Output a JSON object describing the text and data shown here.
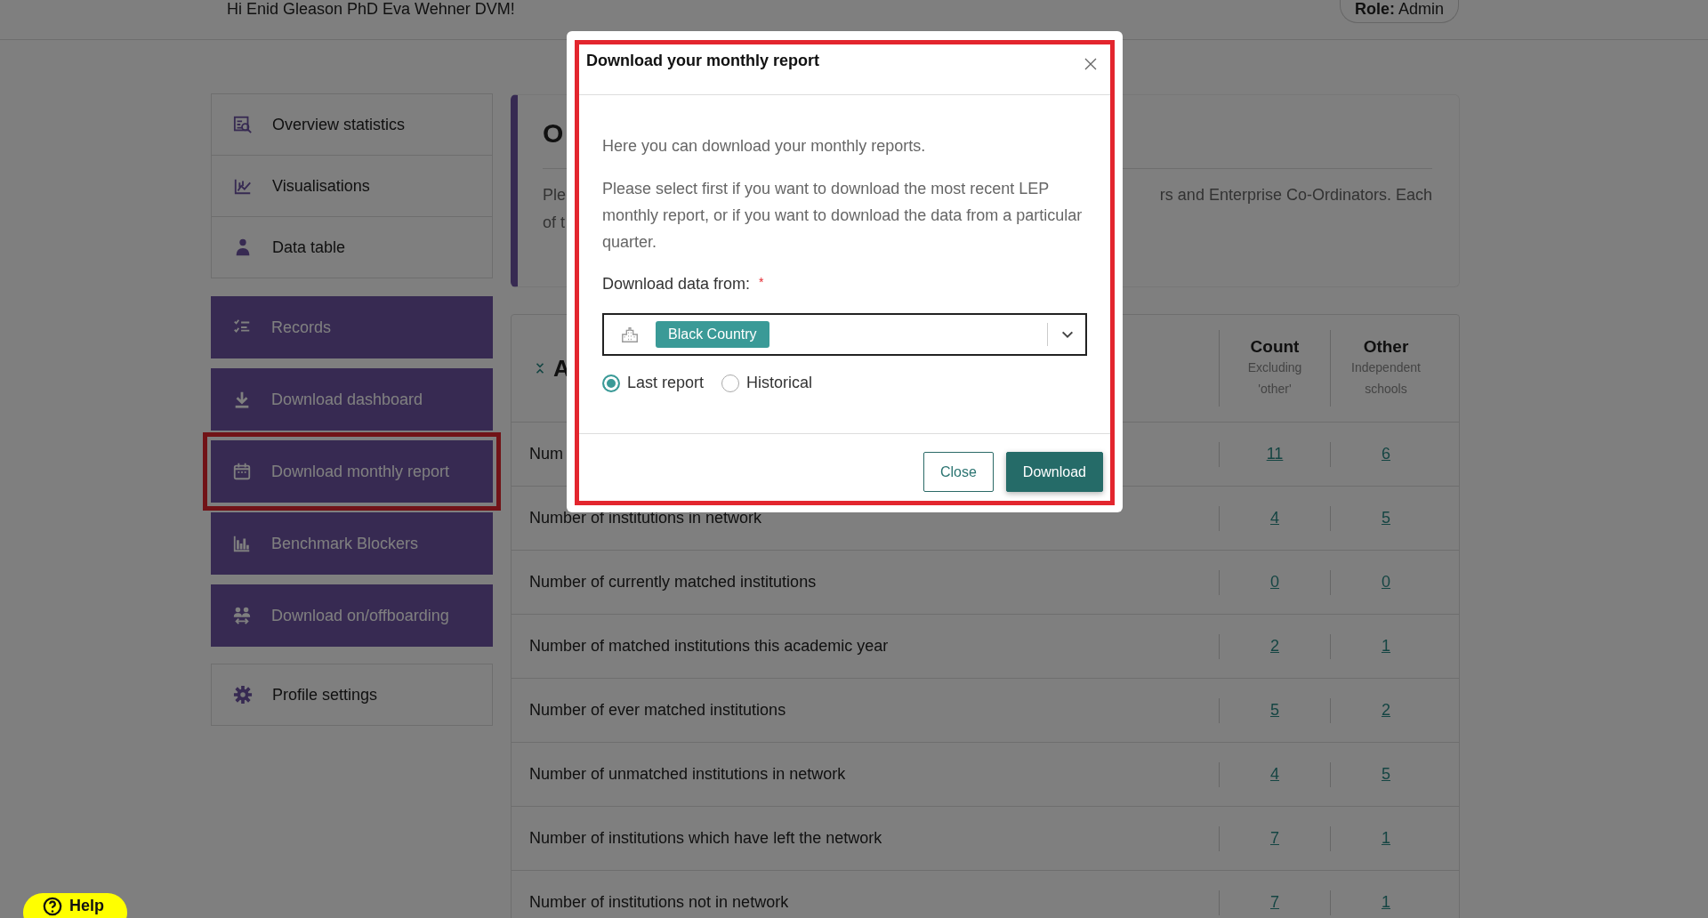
{
  "header": {
    "greeting": "Hi Enid Gleason PhD Eva Wehner DVM!",
    "role_label": "Role:",
    "role_value": "Admin"
  },
  "sidebar": {
    "groups": [
      {
        "kind": "plain",
        "items": [
          {
            "label": "Overview statistics",
            "highlighted": false
          },
          {
            "label": "Visualisations",
            "highlighted": false
          },
          {
            "label": "Data table",
            "highlighted": false
          }
        ]
      },
      {
        "kind": "primary",
        "items": [
          {
            "label": "Records",
            "highlighted": false
          },
          {
            "label": "Download dashboard",
            "highlighted": false
          },
          {
            "label": "Download monthly report",
            "highlighted": true
          },
          {
            "label": "Benchmark Blockers",
            "highlighted": false
          },
          {
            "label": "Download on/offboarding",
            "highlighted": false
          }
        ]
      },
      {
        "kind": "plain",
        "items": [
          {
            "label": "Profile settings",
            "highlighted": false
          }
        ]
      }
    ]
  },
  "overview_card": {
    "title": "O",
    "text_left": [
      "Ple",
      "of t"
    ],
    "text_right": "rs and Enterprise Co-Ordinators. Each"
  },
  "stats_table": {
    "title": "A",
    "columns": [
      {
        "title": "Count",
        "subtitle": "Excluding 'other'"
      },
      {
        "title": "Other",
        "subtitle": "Independent schools"
      }
    ],
    "rows": [
      {
        "label": "Num",
        "count": "11",
        "other": "6"
      },
      {
        "label": "Number of institutions in network",
        "count": "4",
        "other": "5"
      },
      {
        "label": "Number of currently matched institutions",
        "count": "0",
        "other": "0"
      },
      {
        "label": "Number of matched institutions this academic year",
        "count": "2",
        "other": "1"
      },
      {
        "label": "Number of ever matched institutions",
        "count": "5",
        "other": "2"
      },
      {
        "label": "Number of unmatched institutions in network",
        "count": "4",
        "other": "5"
      },
      {
        "label": "Number of institutions which have left the network",
        "count": "7",
        "other": "1"
      },
      {
        "label": "Number of institutions not in network",
        "count": "7",
        "other": "1"
      }
    ]
  },
  "modal": {
    "title": "Download your monthly report",
    "highlighted": true,
    "intro": "Here you can download your monthly reports.",
    "paragraph": "Please select first if you want to download the most recent LEP monthly report, or if you want to download the data from a particular quarter.",
    "field_label": "Download data from:",
    "required_mark": "*",
    "select_value": "Black Country",
    "radios": [
      {
        "label": "Last report",
        "selected": true
      },
      {
        "label": "Historical",
        "selected": false
      }
    ],
    "buttons": [
      {
        "label": "Close",
        "kind": "secondary"
      },
      {
        "label": "Download",
        "kind": "primary"
      }
    ]
  },
  "help_button": {
    "label": "Help"
  }
}
